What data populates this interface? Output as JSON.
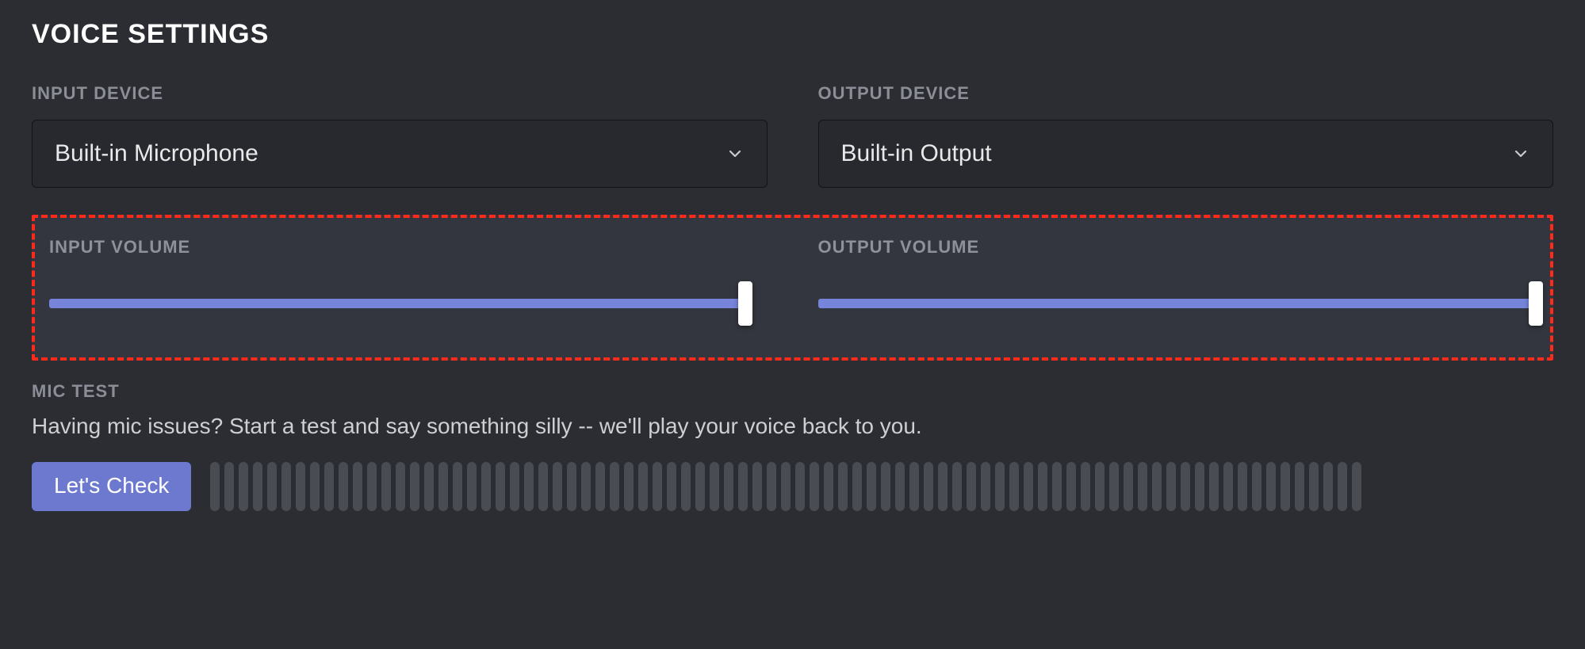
{
  "section_title": "VOICE SETTINGS",
  "input_device": {
    "label": "INPUT DEVICE",
    "value": "Built-in Microphone"
  },
  "output_device": {
    "label": "OUTPUT DEVICE",
    "value": "Built-in Output"
  },
  "input_volume": {
    "label": "INPUT VOLUME",
    "percent": 97
  },
  "output_volume": {
    "label": "OUTPUT VOLUME",
    "percent": 100
  },
  "mic_test": {
    "label": "MIC TEST",
    "desc": "Having mic issues? Start a test and say something silly -- we'll play your voice back to you.",
    "button": "Let's Check",
    "vu_bar_count": 81
  },
  "colors": {
    "accent": "#7684d9",
    "button": "#6d79cf",
    "highlight_border": "#ff2a1a"
  }
}
